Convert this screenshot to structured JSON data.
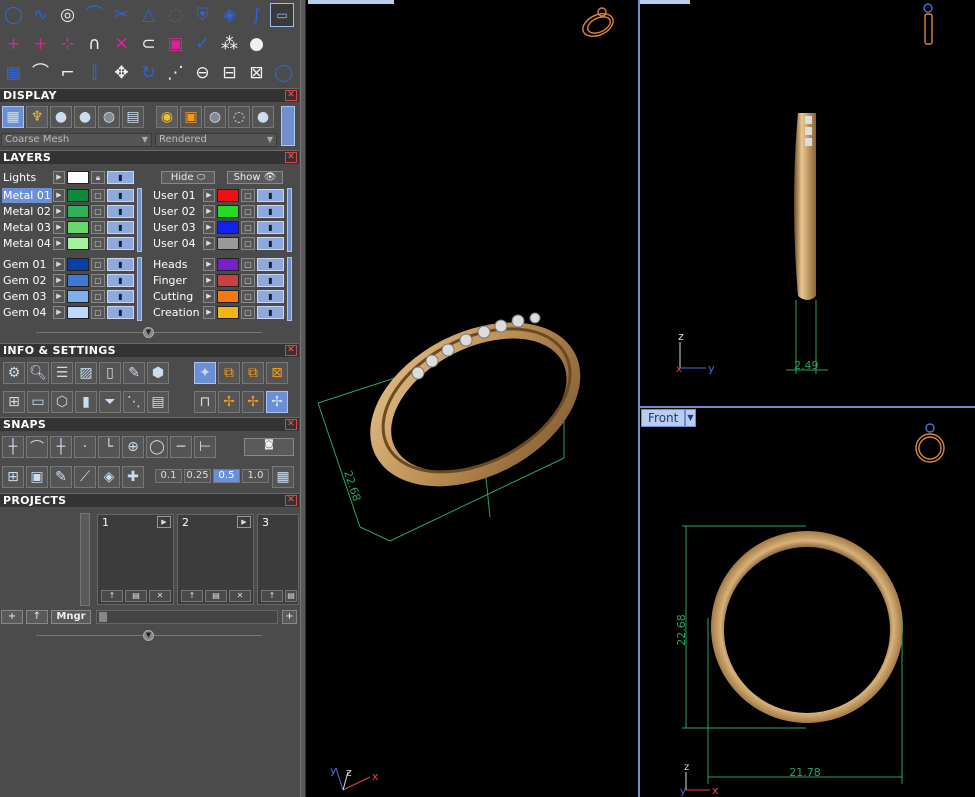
{
  "colors": {
    "panel_bg": "#4b4b4b",
    "viewport_bg": "#000000",
    "dimension_green": "#29a463",
    "ring_gold": "#c8a06a",
    "selection_blue": "#6c8fd9"
  },
  "toolbar": {
    "row1_icons": [
      "circle-icon",
      "curve-icon",
      "ring-icon",
      "bend-icon",
      "scissors-icon",
      "cone-icon",
      "rail-icon",
      "shield-icon",
      "gem-icon",
      "profile-icon",
      "layout-icon"
    ],
    "row2_icons": [
      "add-point-icon",
      "add-point-center-icon",
      "insert-point-icon",
      "arc-icon",
      "delete-point-icon",
      "link-icon",
      "random-icon",
      "check-icon",
      "scatter-icon",
      "blob-icon"
    ],
    "row3_icons": [
      "cubes-icon",
      "arc-tool-icon",
      "sweep-icon",
      "mirror-icon",
      "move-icon",
      "rotate-icon",
      "explode-icon",
      "chain-icon",
      "split-icon",
      "cut-icon",
      "torus-icon"
    ]
  },
  "display": {
    "title": "DISPLAY",
    "mesh_mode": "Coarse Mesh",
    "render_mode": "Rendered"
  },
  "layers": {
    "title": "LAYERS",
    "lights_label": "Lights",
    "hide_label": "Hide",
    "show_label": "Show",
    "left_column": [
      {
        "name": "Metal 01",
        "color": "#0f8a3c",
        "selected": true
      },
      {
        "name": "Metal 02",
        "color": "#2fb05a",
        "selected": false
      },
      {
        "name": "Metal 03",
        "color": "#6bd66b",
        "selected": false
      },
      {
        "name": "Metal 04",
        "color": "#a6f0a0",
        "selected": false
      },
      {
        "name": "Gem 01",
        "color": "#0b3fa8",
        "selected": false
      },
      {
        "name": "Gem 02",
        "color": "#3f79d6",
        "selected": false
      },
      {
        "name": "Gem 03",
        "color": "#7fb0ee",
        "selected": false
      },
      {
        "name": "Gem 04",
        "color": "#bcd8fb",
        "selected": false
      }
    ],
    "right_column": [
      {
        "name": "User 01",
        "color": "#ee1111"
      },
      {
        "name": "User 02",
        "color": "#22dd22"
      },
      {
        "name": "User 03",
        "color": "#1122ee"
      },
      {
        "name": "User 04",
        "color": "#999999"
      },
      {
        "name": "Heads",
        "color": "#7a1fc8"
      },
      {
        "name": "Finger",
        "color": "#c84040"
      },
      {
        "name": "Cutting",
        "color": "#f07a10"
      },
      {
        "name": "Creation",
        "color": "#f2b51a"
      }
    ]
  },
  "info": {
    "title": "INFO & SETTINGS"
  },
  "snaps": {
    "title": "SNAPS",
    "grid_values": [
      "0.1",
      "0.25",
      "0.5",
      "1.0"
    ],
    "selected_value": "0.5"
  },
  "projects": {
    "title": "PROJECTS",
    "slots": [
      "1",
      "2",
      "3"
    ],
    "mngr_label": "Mngr"
  },
  "viewports": {
    "perspective": {
      "dimension_height": "22.68"
    },
    "right": {
      "dimension_width": "2.49",
      "axis_z": "z",
      "axis_y": "y",
      "axis_x": "x"
    },
    "front": {
      "label": "Front",
      "dimension_height": "22.68",
      "dimension_width": "21.78",
      "axis_z": "z",
      "axis_y": "y",
      "axis_x": "x"
    },
    "persp_axes": {
      "axis_y": "y",
      "axis_z": "z",
      "axis_x": "x"
    }
  }
}
